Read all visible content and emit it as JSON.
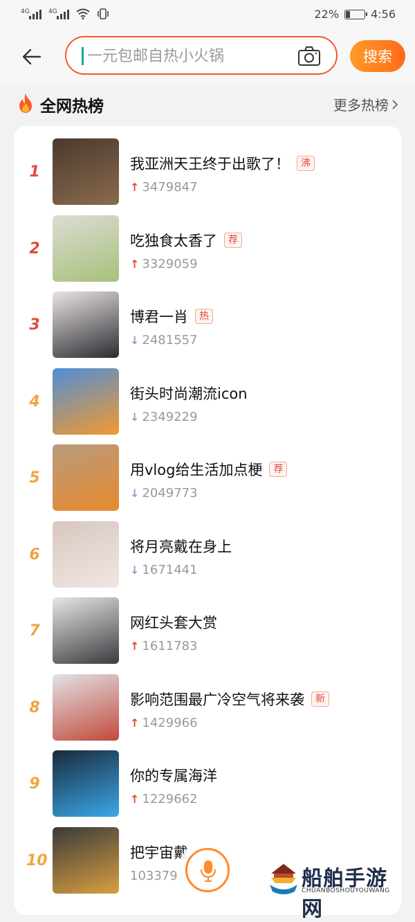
{
  "status_bar": {
    "sim1_label": "4G",
    "sim2_label": "4G",
    "battery_text": "22%",
    "battery_level": 0.22,
    "time": "4:56"
  },
  "header": {
    "search_placeholder": "一元包邮自热小火锅",
    "search_button": "搜索",
    "accent": "#f05a28"
  },
  "section": {
    "title": "全网热榜",
    "more_label": "更多热榜"
  },
  "list": [
    {
      "rank": "1",
      "title": "我亚洲天王终于出歌了！",
      "tag": "沸",
      "trend": "up",
      "count": "3479847",
      "rank_color": "#e24a3b",
      "thumb_colors": [
        "#4a3a2e",
        "#8a6a4e"
      ]
    },
    {
      "rank": "2",
      "title": "吃独食太香了",
      "tag": "荐",
      "trend": "up",
      "count": "3329059",
      "rank_color": "#e24a3b",
      "thumb_colors": [
        "#dcdcd4",
        "#a7c07a"
      ]
    },
    {
      "rank": "3",
      "title": "博君一肖",
      "tag": "热",
      "trend": "down",
      "count": "2481557",
      "rank_color": "#e24a3b",
      "thumb_colors": [
        "#e9e3e6",
        "#2c2c30"
      ]
    },
    {
      "rank": "4",
      "title": "街头时尚潮流icon",
      "tag": "",
      "trend": "down",
      "count": "2349229",
      "rank_color": "#f0a540",
      "thumb_colors": [
        "#4f8ed8",
        "#f29a2e"
      ]
    },
    {
      "rank": "5",
      "title": "用vlog给生活加点梗",
      "tag": "荐",
      "trend": "down",
      "count": "2049773",
      "rank_color": "#f0a540",
      "thumb_colors": [
        "#b79a7e",
        "#e98a2c"
      ]
    },
    {
      "rank": "6",
      "title": "将月亮戴在身上",
      "tag": "",
      "trend": "down",
      "count": "1671441",
      "rank_color": "#f0a540",
      "thumb_colors": [
        "#d8c7c0",
        "#f1e6e2"
      ]
    },
    {
      "rank": "7",
      "title": "网红头套大赏",
      "tag": "",
      "trend": "up",
      "count": "1611783",
      "rank_color": "#f0a540",
      "thumb_colors": [
        "#e8e6e4",
        "#3b3b40"
      ]
    },
    {
      "rank": "8",
      "title": "影响范围最广冷空气将来袭",
      "tag": "新",
      "trend": "up",
      "count": "1429966",
      "rank_color": "#f0a540",
      "thumb_colors": [
        "#e2e2e6",
        "#c24a3a"
      ]
    },
    {
      "rank": "9",
      "title": "你的专属海洋",
      "tag": "",
      "trend": "up",
      "count": "1229662",
      "rank_color": "#f0a540",
      "thumb_colors": [
        "#1a2a3a",
        "#3aa8e8"
      ]
    },
    {
      "rank": "10",
      "title": "把宇宙戴",
      "tag": "",
      "trend": "",
      "count": "103379",
      "rank_color": "#f0a540",
      "thumb_colors": [
        "#3a3a3a",
        "#d8a040"
      ]
    }
  ],
  "watermark": {
    "text": "船舶手游网",
    "sub": "CHUANBOSHOUYOUWANG"
  },
  "colors": {
    "trend_up": "#e24a3b",
    "trend_down": "#8aa0c8"
  }
}
